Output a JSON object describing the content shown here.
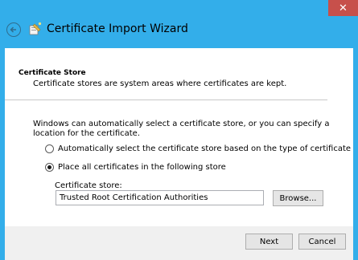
{
  "window": {
    "title": "Certificate Import Wizard",
    "close_glyph": "✕"
  },
  "page": {
    "header_title": "Certificate Store",
    "header_description": "Certificate stores are system areas where certificates are kept.",
    "intro": "Windows can automatically select a certificate store, or you can specify a location for the certificate.",
    "options": [
      {
        "label": "Automatically select the certificate store based on the type of certificate",
        "selected": false
      },
      {
        "label": "Place all certificates in the following store",
        "selected": true
      }
    ],
    "store_label": "Certificate store:",
    "store_value": "Trusted Root Certification Authorities",
    "browse_label": "Browse..."
  },
  "footer": {
    "next_label": "Next",
    "cancel_label": "Cancel"
  },
  "colors": {
    "window_frame": "#33aeea",
    "close_button": "#c7504b"
  }
}
